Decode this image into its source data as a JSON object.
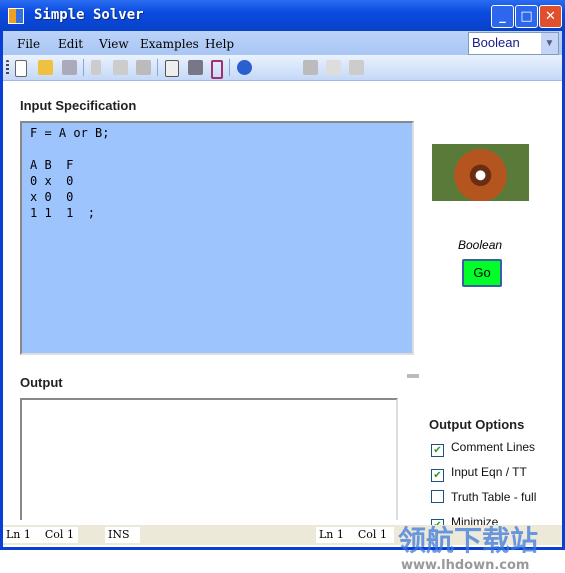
{
  "window": {
    "title": "Simple Solver",
    "minimize": "_",
    "maximize": "□",
    "close": "✕"
  },
  "menu": [
    "File",
    "Edit",
    "View",
    "Examples",
    "Help"
  ],
  "mode_select": {
    "value": "Boolean"
  },
  "toolbar": [
    "new-icon",
    "open-icon",
    "save-icon",
    "cut-icon",
    "copy-icon",
    "paste-icon",
    "print-preview-icon",
    "print-icon",
    "page-setup-icon",
    "help-icon",
    "save-output-icon",
    "preview-output-icon",
    "print-output-icon"
  ],
  "input": {
    "label": "Input Specification",
    "text": "F = A or B;\n\nA B  F\n0 x  0\nx 0  0\n1 1  1  ;"
  },
  "output": {
    "label": "Output",
    "text": ""
  },
  "side": {
    "mode_label": "Boolean",
    "go": "Go"
  },
  "options": {
    "title": "Output Options",
    "items": [
      {
        "label": "Comment Lines",
        "checked": true
      },
      {
        "label": "Input Eqn / TT",
        "checked": true
      },
      {
        "label": "Truth Table - full",
        "checked": false
      },
      {
        "label": "Minimize",
        "checked": true
      }
    ]
  },
  "status": {
    "left_ln": "Ln 1",
    "left_col": "Col 1",
    "ins": "INS",
    "right_ln": "Ln 1",
    "right_col": "Col 1"
  },
  "watermark": {
    "text": "领航下载站",
    "url": "www.lhdown.com"
  }
}
